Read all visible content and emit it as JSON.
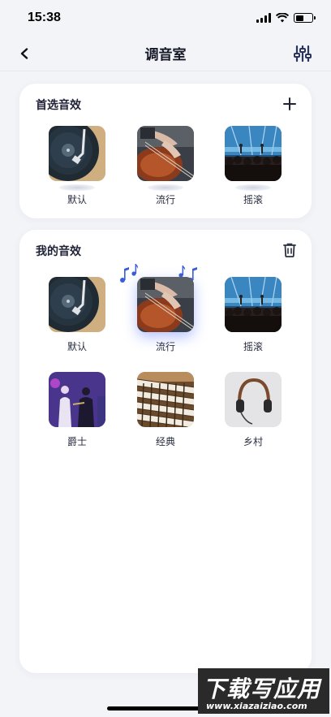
{
  "status_bar": {
    "time": "15:38",
    "battery_level": 0.5
  },
  "nav": {
    "title": "调音室",
    "back_icon": "chevron-left-icon",
    "action_icon": "sliders-icon"
  },
  "preferred": {
    "title": "首选音效",
    "action_icon": "plus-icon",
    "items": [
      {
        "label": "默认",
        "image": "turntable"
      },
      {
        "label": "流行",
        "image": "guitar"
      },
      {
        "label": "摇滚",
        "image": "concert"
      }
    ]
  },
  "mine": {
    "title": "我的音效",
    "action_icon": "trash-icon",
    "selected": "流行",
    "items": [
      {
        "label": "默认",
        "image": "turntable"
      },
      {
        "label": "流行",
        "image": "guitar"
      },
      {
        "label": "摇滚",
        "image": "concert"
      },
      {
        "label": "爵士",
        "image": "jazz-band"
      },
      {
        "label": "经典",
        "image": "organ-keys"
      },
      {
        "label": "乡村",
        "image": "headphones"
      }
    ]
  },
  "watermark": {
    "big": "下载写应用",
    "small": "www.xiazaiziao.com"
  },
  "colors": {
    "accent": "#5a78ff",
    "background": "#f3f4f8",
    "card": "#ffffff"
  }
}
